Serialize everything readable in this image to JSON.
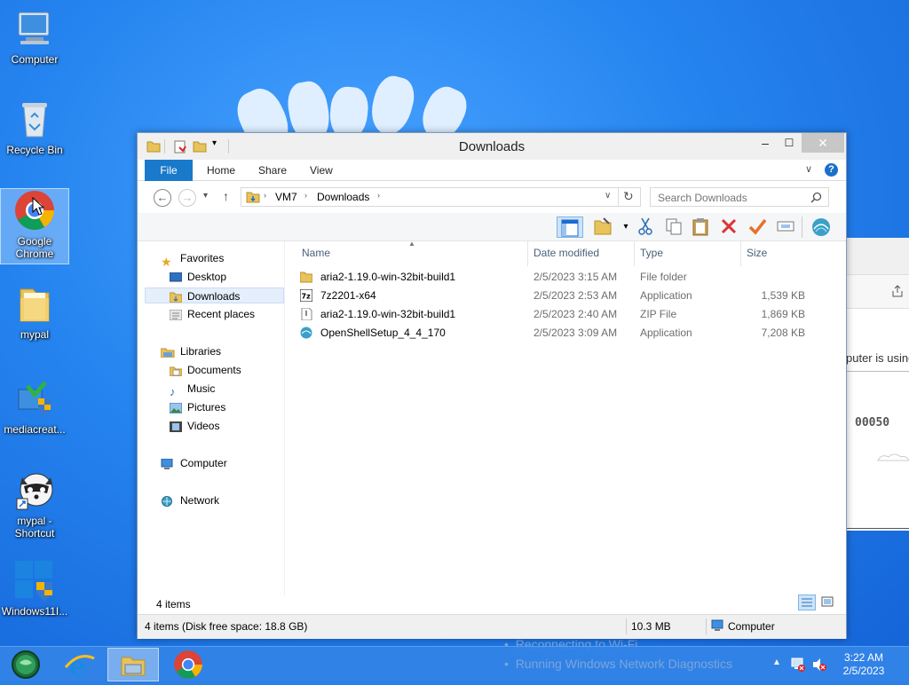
{
  "desktop": {
    "icons": [
      {
        "label": "Computer"
      },
      {
        "label": "Recycle Bin"
      },
      {
        "label": "Google Chrome"
      },
      {
        "label": "mypal"
      },
      {
        "label": "mediacreat..."
      },
      {
        "label": "mypal - Shortcut"
      },
      {
        "label": "Windows11I..."
      }
    ]
  },
  "background_window": {
    "text1": "puter is using",
    "counter": "00050"
  },
  "network_panel": {
    "items": [
      "Reconnecting to Wi-Fi",
      "Running Windows Network Diagnostics"
    ]
  },
  "window": {
    "title": "Downloads",
    "ribbon_tabs": [
      "File",
      "Home",
      "Share",
      "View"
    ],
    "address": {
      "segments": [
        "VM7",
        "Downloads"
      ]
    },
    "search": {
      "placeholder": "Search Downloads"
    },
    "nav": {
      "favorites": "Favorites",
      "desktop": "Desktop",
      "downloads": "Downloads",
      "recent": "Recent places",
      "libraries": "Libraries",
      "documents": "Documents",
      "music": "Music",
      "pictures": "Pictures",
      "videos": "Videos",
      "computer": "Computer",
      "network": "Network"
    },
    "columns": {
      "name": "Name",
      "date": "Date modified",
      "type": "Type",
      "size": "Size"
    },
    "files": [
      {
        "name": "aria2-1.19.0-win-32bit-build1",
        "date": "2/5/2023 3:15 AM",
        "type": "File folder",
        "size": "",
        "icon": "folder-icon"
      },
      {
        "name": "7z2201-x64",
        "date": "2/5/2023 2:53 AM",
        "type": "Application",
        "size": "1,539 KB",
        "icon": "7zip-icon"
      },
      {
        "name": "aria2-1.19.0-win-32bit-build1",
        "date": "2/5/2023 2:40 AM",
        "type": "ZIP File",
        "size": "1,869 KB",
        "icon": "zip-icon"
      },
      {
        "name": "OpenShellSetup_4_4_170",
        "date": "2/5/2023 3:09 AM",
        "type": "Application",
        "size": "7,208 KB",
        "icon": "shell-icon"
      }
    ],
    "item_count": "4 items",
    "status": {
      "left": "4 items (Disk free space: 18.8 GB)",
      "size": "10.3 MB",
      "location": "Computer"
    }
  },
  "taskbar": {
    "time": "3:22 AM",
    "date": "2/5/2023"
  },
  "colors": {
    "accent": "#1979ca",
    "desktop": "#2584ef"
  }
}
